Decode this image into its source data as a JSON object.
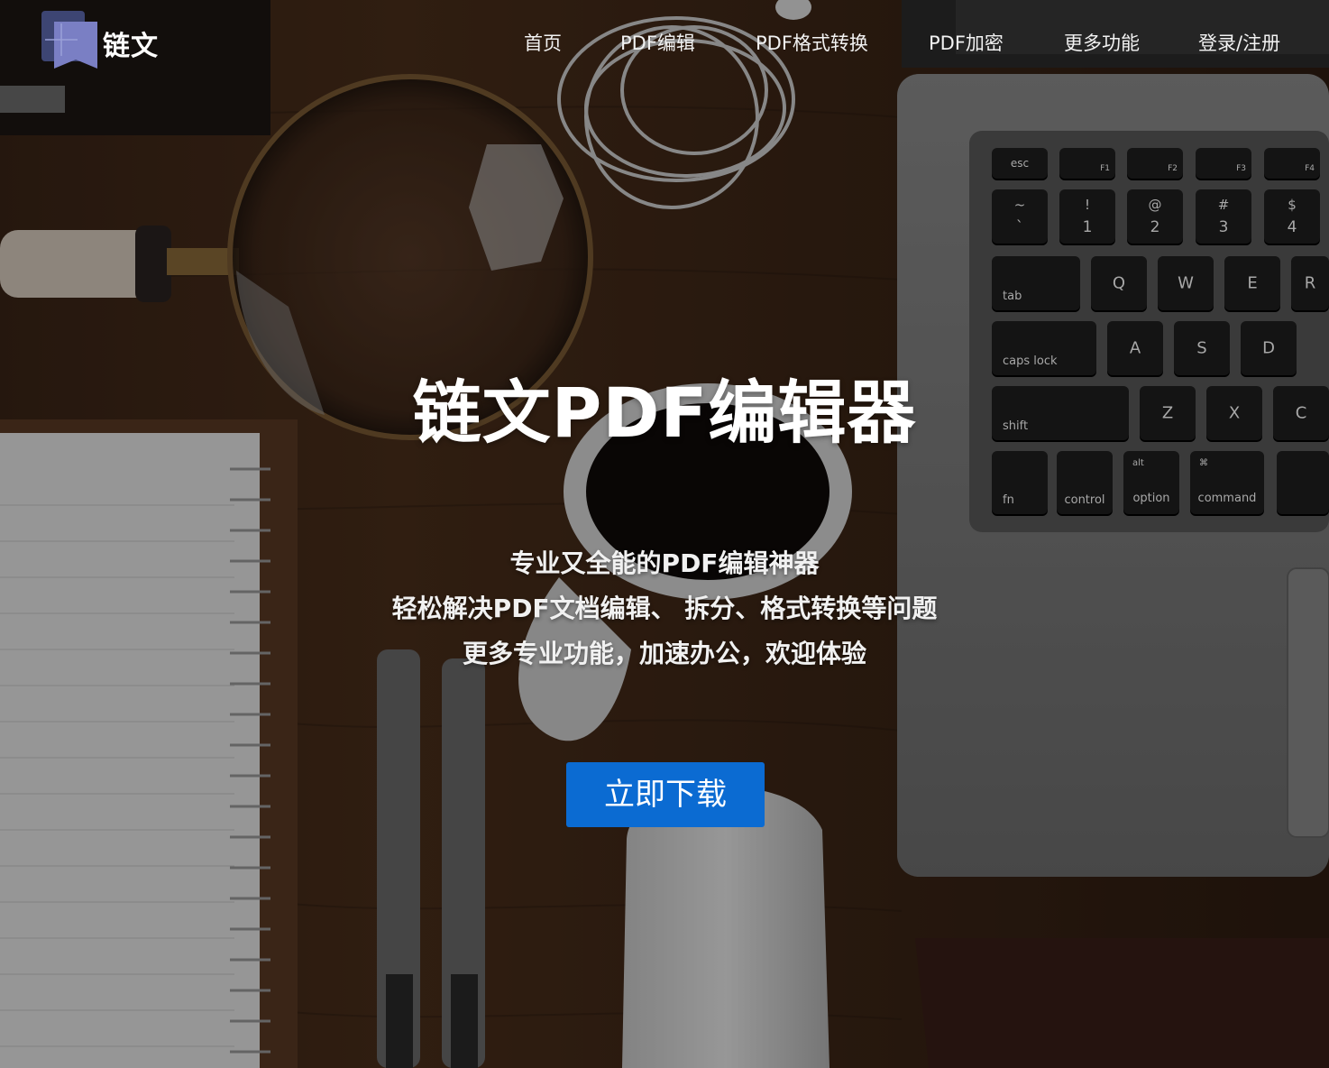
{
  "brand": {
    "name": "链文"
  },
  "nav": {
    "items": [
      {
        "label": "首页"
      },
      {
        "label": "PDF编辑"
      },
      {
        "label": "PDF格式转换"
      },
      {
        "label": "PDF加密"
      },
      {
        "label": "更多功能"
      },
      {
        "label": "登录/注册"
      }
    ]
  },
  "hero": {
    "title": "链文PDF编辑器",
    "subtitle_lines": [
      "专业又全能的PDF编辑神器",
      "轻松解决PDF文档编辑、 拆分、格式转换等问题",
      "更多专业功能，加速办公，欢迎体验"
    ],
    "cta_label": "立即下载"
  },
  "background": {
    "keyboard_keys": [
      "esc",
      "F1",
      "F2",
      "F3",
      "F4",
      "~",
      "`",
      "!",
      "1",
      "@",
      "2",
      "#",
      "3",
      "$",
      "4",
      "tab",
      "Q",
      "W",
      "E",
      "R",
      "caps lock",
      "A",
      "S",
      "D",
      "shift",
      "Z",
      "X",
      "C",
      "fn",
      "control",
      "alt",
      "option",
      "⌘",
      "command"
    ]
  },
  "colors": {
    "cta": "#0b6bd2",
    "logo_dark": "#3d4573",
    "logo_light": "#7a7fc4"
  }
}
